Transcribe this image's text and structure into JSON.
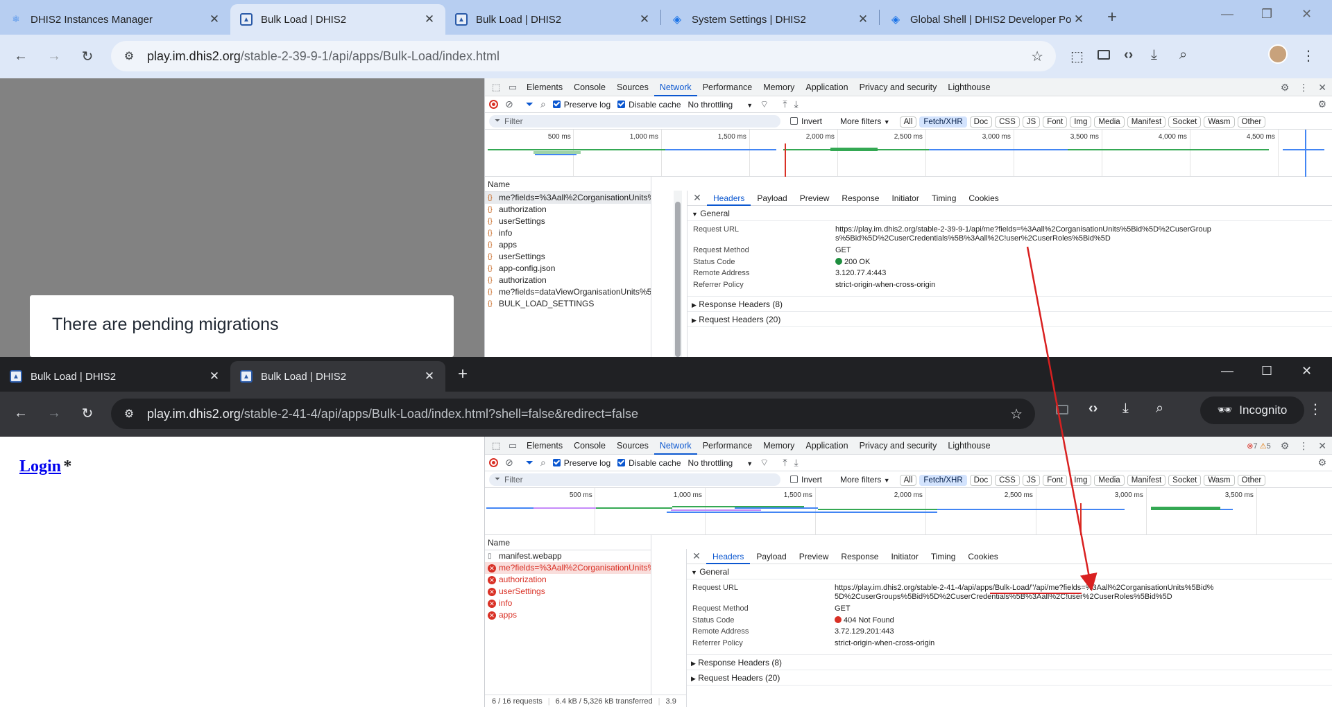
{
  "window1": {
    "tabs": [
      {
        "title": "DHIS2 Instances Manager",
        "favicon": "react-icon"
      },
      {
        "title": "Bulk Load | DHIS2",
        "favicon": "dhis2-icon",
        "active": true
      },
      {
        "title": "Bulk Load | DHIS2",
        "favicon": "dhis2-icon"
      },
      {
        "title": "System Settings | DHIS2",
        "favicon": "dhis2-diamond-icon"
      },
      {
        "title": "Global Shell | DHIS2 Developer Po",
        "favicon": "dhis2-diamond-icon"
      }
    ],
    "url_host": "play.im.dhis2.org",
    "url_path": "/stable-2-39-9-1/api/apps/Bulk-Load/index.html",
    "dialog_title": "There are pending migrations",
    "devtools": {
      "tabs": [
        "Elements",
        "Console",
        "Sources",
        "Network",
        "Performance",
        "Memory",
        "Application",
        "Privacy and security",
        "Lighthouse"
      ],
      "active_tab": "Network",
      "preserve_log": "Preserve log",
      "disable_cache": "Disable cache",
      "throttling": "No throttling",
      "filter_placeholder": "Filter",
      "invert": "Invert",
      "more_filters": "More filters",
      "type_filters": [
        "All",
        "Fetch/XHR",
        "Doc",
        "CSS",
        "JS",
        "Font",
        "Img",
        "Media",
        "Manifest",
        "Socket",
        "Wasm",
        "Other"
      ],
      "active_type_filter": "Fetch/XHR",
      "timeline_ticks": [
        "500 ms",
        "1,000 ms",
        "1,500 ms",
        "2,000 ms",
        "2,500 ms",
        "3,000 ms",
        "3,500 ms",
        "4,000 ms",
        "4,500 ms"
      ],
      "name_header": "Name",
      "requests": [
        "me?fields=%3Aall%2CorganisationUnits%5Bi...",
        "authorization",
        "userSettings",
        "info",
        "apps",
        "userSettings",
        "app-config.json",
        "authorization",
        "me?fields=dataViewOrganisationUnits%5Bid...",
        "BULK_LOAD_SETTINGS"
      ],
      "detail_tabs": [
        "Headers",
        "Payload",
        "Preview",
        "Response",
        "Initiator",
        "Timing",
        "Cookies"
      ],
      "general_label": "General",
      "general": {
        "request_url_key": "Request URL",
        "request_url": "https://play.im.dhis2.org/stable-2-39-9-1/api/me?fields=%3Aall%2CorganisationUnits%5Bid%5D%2CuserGroups%5Bid%5D%2CuserCredentials%5B%3Aall%2C!user%2CuserRoles%5Bid%5D",
        "method_key": "Request Method",
        "method": "GET",
        "status_key": "Status Code",
        "status": "200 OK",
        "remote_key": "Remote Address",
        "remote": "3.120.77.4:443",
        "referrer_key": "Referrer Policy",
        "referrer": "strict-origin-when-cross-origin"
      },
      "response_headers": "Response Headers (8)",
      "request_headers": "Request Headers (20)"
    }
  },
  "window2": {
    "tabs": [
      {
        "title": "Bulk Load | DHIS2",
        "favicon": "dhis2-icon"
      },
      {
        "title": "Bulk Load | DHIS2",
        "favicon": "dhis2-icon",
        "active": true
      }
    ],
    "url_host": "play.im.dhis2.org",
    "url_path": "/stable-2-41-4/api/apps/Bulk-Load/index.html?shell=false&redirect=false",
    "incognito": "Incognito",
    "login_link": "Login",
    "login_suffix": "*",
    "devtools": {
      "errors": "7",
      "warnings": "5",
      "timeline_ticks": [
        "500 ms",
        "1,000 ms",
        "1,500 ms",
        "2,000 ms",
        "2,500 ms",
        "3,000 ms",
        "3,500 ms"
      ],
      "requests": [
        {
          "name": "manifest.webapp",
          "error": false
        },
        {
          "name": "me?fields=%3Aall%2CorganisationUnits%5Bid%...",
          "error": true,
          "selected": true
        },
        {
          "name": "authorization",
          "error": true
        },
        {
          "name": "userSettings",
          "error": true
        },
        {
          "name": "info",
          "error": true
        },
        {
          "name": "apps",
          "error": true
        }
      ],
      "footer": [
        "6 / 16 requests",
        "6.4 kB / 5,326 kB transferred",
        "3.9"
      ],
      "general": {
        "request_url": "https://play.im.dhis2.org/stable-2-41-4/api/apps/Bulk-Load/\"/api/me?fields=%3Aall%2CorganisationUnits%5Bid%5D%2CuserGroups%5Bid%5D%2CuserCredentials%5B%3Aall%2C!user%2CuserRoles%5Bid%5D",
        "method": "GET",
        "status": "404 Not Found",
        "remote": "3.72.129.201:443",
        "referrer": "strict-origin-when-cross-origin"
      }
    }
  },
  "colors": {
    "accent": "#0b57d0",
    "error": "#d93025",
    "ok": "#1e8e3e",
    "annotation": "#d92020"
  }
}
